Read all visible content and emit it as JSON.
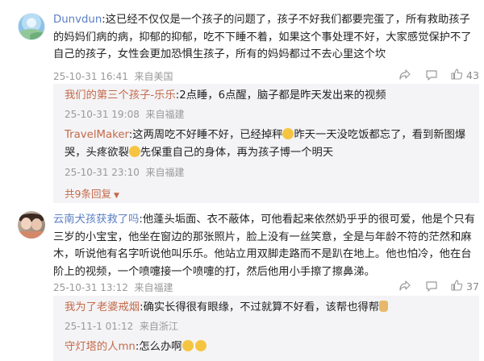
{
  "comments": [
    {
      "user": "Dunvdun",
      "text": "这已经不仅仅是一个孩子的问题了，孩子不好我们都要完蛋了，所有救助孩子的妈妈们病的病，抑郁的抑郁，吃不下睡不着，如果这个事处理不好，大家感觉保护不了自己的孩子，女性会更加恐惧生孩子，所有的妈妈都过不去心里这个坎",
      "time": "25-10-31 16:41",
      "location": "来自美国",
      "likes": "43",
      "replies": [
        {
          "user": "我们的第三个孩子-乐乐",
          "text": "2点睡，6点醒，脑子都是昨天发出来的视频",
          "time": "25-10-31 19:08",
          "location": "来自福建"
        },
        {
          "user": "TravelMaker",
          "text_a": "这两周吃不好睡不好，已经掉秤",
          "text_b": "昨天一天没吃饭都忘了，看到新图爆哭，头疼欲裂",
          "text_c": "先保重自己的身体，再为孩子博一个明天",
          "time": "25-10-31 23:10",
          "location": "来自福建"
        }
      ],
      "more_replies": "共9条回复"
    },
    {
      "user": "云南犬孩获救了吗",
      "text": "他蓬头垢面、衣不蔽体，可他看起来依然奶乎乎的很可爱，他是个只有三岁的小宝宝，他坐在窗边的那张照片，脸上没有一丝笑意，全是与年龄不符的茫然和麻木，听说他有名字听说他叫乐乐。他站立用双脚走路而不是趴在地上。他也怕冷，他在台阶上的视频，一个喷嚏接一个喷嚏的打，然后他用小手擦了擦鼻涕。",
      "time": "25-10-31 13:12",
      "location": "来自福建",
      "likes": "37",
      "replies": [
        {
          "user": "我为了老婆戒烟",
          "text": "确实长得很有眼缘，不过就算不好看，该帮也得帮",
          "time": "25-11-1 01:12",
          "location": "来自浙江"
        },
        {
          "user": "守灯塔的人mn",
          "text": "怎么办啊"
        }
      ]
    }
  ],
  "icons": [
    "share-icon",
    "comment-icon",
    "like-icon"
  ]
}
